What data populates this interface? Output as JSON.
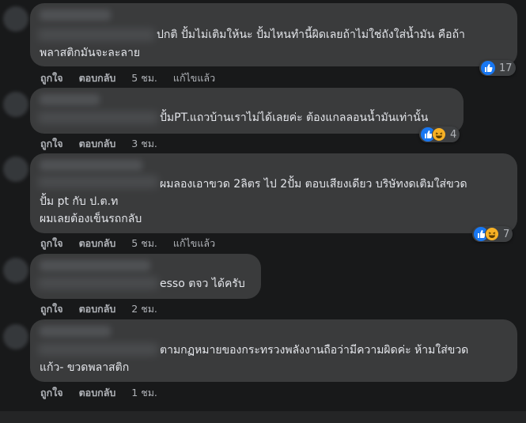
{
  "actions": {
    "like": "ถูกใจ",
    "reply": "ตอบกลับ",
    "edited": "แก้ไขแล้ว"
  },
  "comments": [
    {
      "lines": [
        "ปกติ ปั้มไม่เติมให้นะ ปั้มไหนทำนี้ผิดเลยถ้าไม่ใช่ถังใส่น้ำมัน คือถ้า",
        "พลาสติกมันจะละลาย"
      ],
      "time": "5 ชม.",
      "reactions": "17"
    },
    {
      "lines": [
        "ปั้มPT.แถวบ้านเราไม่ได้เลยค่ะ ต้องแกลลอนน้ำมันเท่านั้น"
      ],
      "time": "3 ชม.",
      "reactions": "4"
    },
    {
      "lines": [
        "ผมลองเอาขวด 2ลิตร ไป 2ปั้ม ตอบเสียงเดียว บริษัทงดเติมใส่ขวด",
        "ปั้ม pt กับ ป.ต.ท",
        "ผมเลยต้องเข็นรถกลับ"
      ],
      "time": "5 ชม.",
      "reactions": "7"
    },
    {
      "lines": [
        "esso ตจว ได้ครับ"
      ],
      "time": "2 ชม."
    },
    {
      "lines": [
        "ตามกฏหมายของกระทรวงพลังงานถือว่ามีความผิดค่ะ ห้ามใส่ขวด",
        "แก้ว- ขวดพลาสติก"
      ],
      "time": "1 ชม."
    }
  ],
  "icons": {
    "like": "thumbs-up-icon",
    "haha": "laughing-face-icon"
  },
  "colors": {
    "background": "#18191a",
    "bubble": "#3a3b3c",
    "like": "#1877f2",
    "haha": "#f7b125"
  }
}
